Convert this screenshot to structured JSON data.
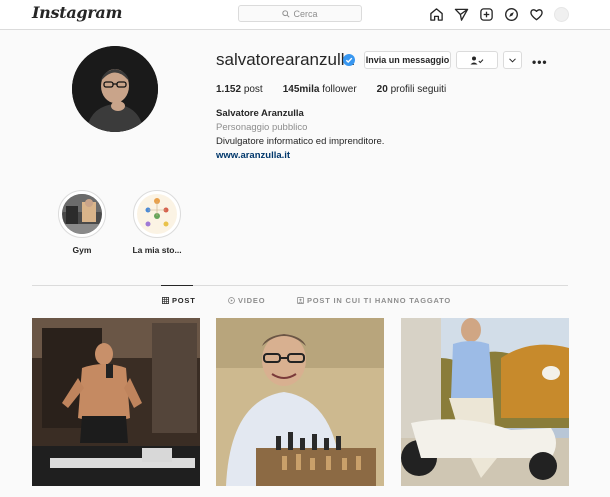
{
  "header": {
    "logo": "Instagram",
    "search_placeholder": "Cerca",
    "icons": [
      "home-icon",
      "direct-icon",
      "new-post-icon",
      "explore-icon",
      "activity-icon",
      "avatar"
    ]
  },
  "profile": {
    "username": "salvatorearanzulla",
    "verified": true,
    "message_button": "Invia un messaggio",
    "stats": {
      "posts_value": "1.152",
      "posts_label": "post",
      "followers_value": "145mila",
      "followers_label": "follower",
      "following_value": "20",
      "following_label": "profili seguiti"
    },
    "bio": {
      "name": "Salvatore Aranzulla",
      "category": "Personaggio pubblico",
      "text": "Divulgatore informatico ed imprenditore.",
      "link": "www.aranzulla.it"
    }
  },
  "highlights": [
    {
      "label": "Gym"
    },
    {
      "label": "La mia sto..."
    }
  ],
  "tabs": [
    {
      "label": "POST",
      "icon": "grid-icon",
      "active": true
    },
    {
      "label": "VIDEO",
      "icon": "video-icon",
      "active": false
    },
    {
      "label": "POST IN CUI TI HANNO TAGGATO",
      "icon": "tagged-icon",
      "active": false
    }
  ],
  "colors": {
    "verified": "#3897f0",
    "link": "#00376b",
    "muted": "#8e8e8e",
    "border": "#dbdbdb"
  }
}
